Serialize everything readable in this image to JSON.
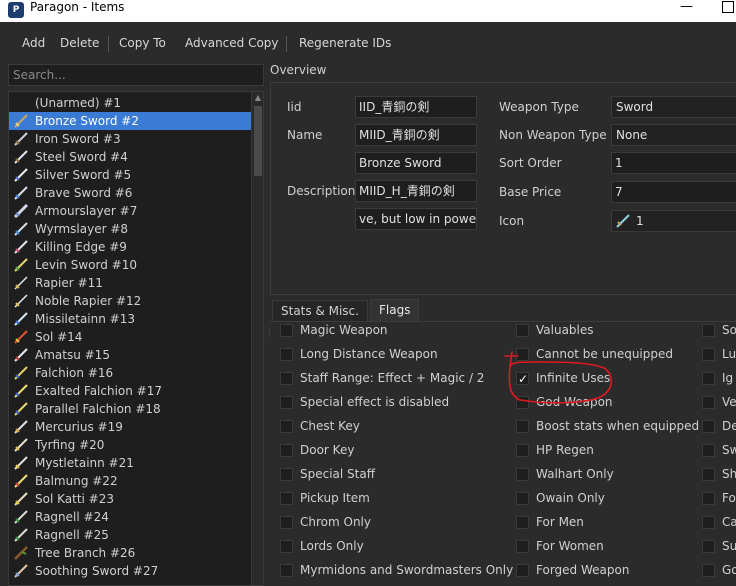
{
  "window": {
    "title": "Paragon - Items",
    "minimize": "—"
  },
  "toolbar": {
    "add": "Add",
    "delete": "Delete",
    "copy_to": "Copy To",
    "advanced_copy": "Advanced Copy",
    "regenerate_ids": "Regenerate IDs"
  },
  "search": {
    "placeholder": "Search..."
  },
  "items": [
    {
      "label": "(Unarmed) #1",
      "icon": "none"
    },
    {
      "label": "Bronze Sword #2",
      "icon": "sword-icon",
      "selected": true
    },
    {
      "label": "Iron Sword #3",
      "icon": "sword-icon"
    },
    {
      "label": "Steel Sword #4",
      "icon": "sword-icon"
    },
    {
      "label": "Silver Sword #5",
      "icon": "sword-icon"
    },
    {
      "label": "Brave Sword #6",
      "icon": "sword-icon"
    },
    {
      "label": "Armourslayer #7",
      "icon": "sword-icon"
    },
    {
      "label": "Wyrmslayer #8",
      "icon": "sword-icon"
    },
    {
      "label": "Killing Edge #9",
      "icon": "sword-icon"
    },
    {
      "label": "Levin Sword #10",
      "icon": "sword-icon"
    },
    {
      "label": "Rapier #11",
      "icon": "sword-icon"
    },
    {
      "label": "Noble Rapier #12",
      "icon": "sword-icon"
    },
    {
      "label": "Missiletainn #13",
      "icon": "sword-icon"
    },
    {
      "label": "Sol #14",
      "icon": "sword-icon"
    },
    {
      "label": "Amatsu #15",
      "icon": "sword-icon"
    },
    {
      "label": "Falchion #16",
      "icon": "sword-icon"
    },
    {
      "label": "Exalted Falchion #17",
      "icon": "sword-icon"
    },
    {
      "label": "Parallel Falchion #18",
      "icon": "sword-icon"
    },
    {
      "label": "Mercurius #19",
      "icon": "sword-icon"
    },
    {
      "label": "Tyrfing #20",
      "icon": "sword-icon"
    },
    {
      "label": "Mystletainn #21",
      "icon": "sword-icon"
    },
    {
      "label": "Balmung #22",
      "icon": "sword-icon"
    },
    {
      "label": "Sol Katti #23",
      "icon": "sword-icon"
    },
    {
      "label": "Ragnell #24",
      "icon": "sword-icon"
    },
    {
      "label": "Ragnell #25",
      "icon": "sword-icon"
    },
    {
      "label": "Tree Branch #26",
      "icon": "sword-icon"
    },
    {
      "label": "Soothing Sword #27",
      "icon": "sword-icon"
    }
  ],
  "overview": {
    "title": "Overview",
    "iid_label": "Iid",
    "iid_value": "IID_青銅の剣",
    "name_label": "Name",
    "name_value": "MIID_青銅の剣",
    "name_display": "Bronze Sword",
    "description_label": "Description",
    "description_value": "MIID_H_青銅の剣",
    "description_text": "ve, but low in power.",
    "weapon_type_label": "Weapon Type",
    "weapon_type_value": "Sword",
    "non_weapon_type_label": "Non Weapon Type",
    "non_weapon_type_value": "None",
    "sort_order_label": "Sort Order",
    "sort_order_value": "1",
    "base_price_label": "Base Price",
    "base_price_value": "7",
    "icon_label": "Icon",
    "icon_value": "1"
  },
  "tabs": [
    {
      "label": "Stats & Misc."
    },
    {
      "label": "Flags",
      "active": true
    }
  ],
  "flags": {
    "col1": [
      "Magic Weapon",
      "Long Distance Weapon",
      "Staff Range: Effect + Magic / 2",
      "Special effect is disabled",
      "Chest Key",
      "Door Key",
      "Special Staff",
      "Pickup Item",
      "Chrom Only",
      "Lords Only",
      "Myrmidons and Swordmasters Only"
    ],
    "col2": [
      "Valuables",
      "Cannot be unequipped",
      "Infinite Uses",
      "God Weapon",
      "Boost stats when equipped",
      "HP Regen",
      "Walhart Only",
      "Owain Only",
      "For Men",
      "For Women",
      "Forged Weapon"
    ],
    "col3": [
      "So",
      "Lu",
      "Ig",
      "Ve",
      "De",
      "Sw",
      "Sh",
      "Fo",
      "Ca",
      "Su",
      "Go"
    ],
    "checked_col2_index": 2
  },
  "colors": {
    "selection": "#3a7bd5",
    "annotation": "#e0191f"
  }
}
